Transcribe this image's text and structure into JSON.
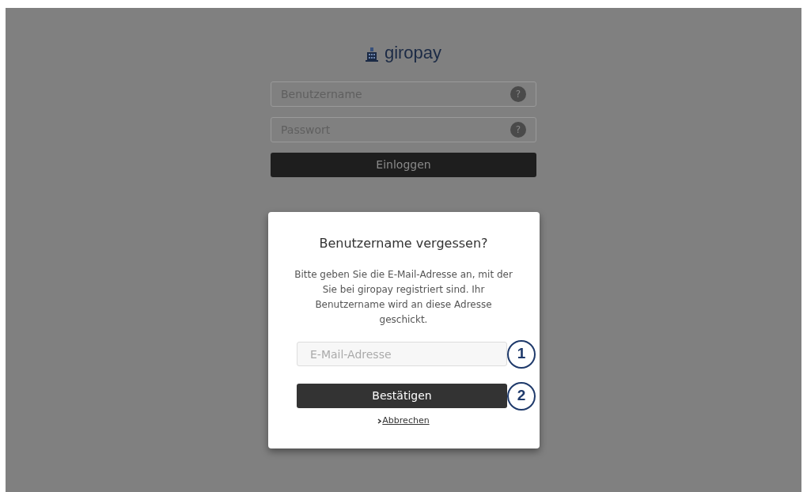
{
  "login": {
    "logo_text": "giropay",
    "fields": [
      {
        "placeholder": "Benutzername",
        "help": "?"
      },
      {
        "placeholder": "Passwort",
        "help": "?"
      }
    ],
    "button": "Einloggen"
  },
  "dialog": {
    "title": "Benutzername vergessen?",
    "text": "Bitte geben Sie die E-Mail-Adresse an, mit der Sie bei giropay registriert sind. Ihr Benutzername wird an diese Adresse geschickt.",
    "field": {
      "placeholder": "E-Mail-Adresse",
      "callout": "1"
    },
    "button": {
      "label": "Bestätigen",
      "callout": "2"
    },
    "cancel_link": "Abbrechen"
  }
}
